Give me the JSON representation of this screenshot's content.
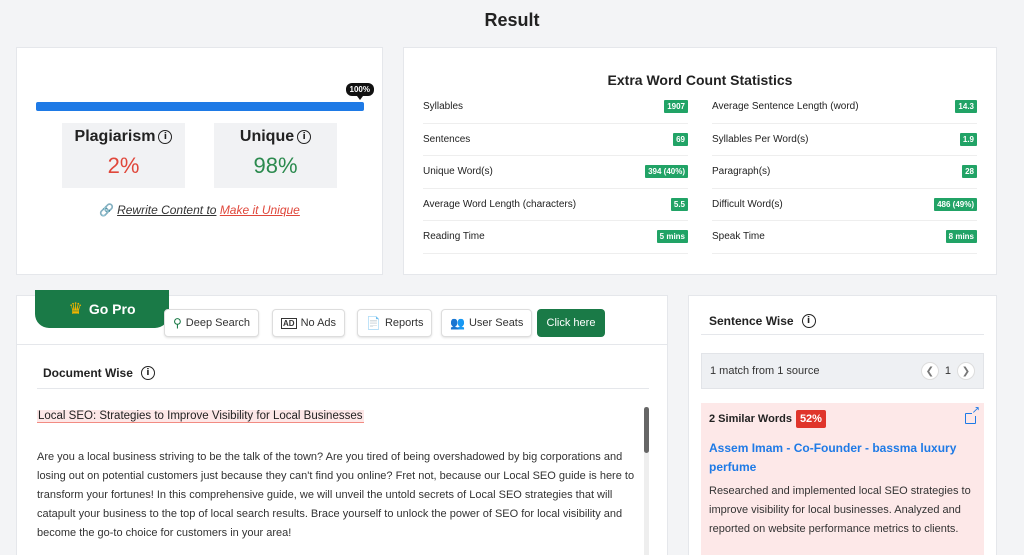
{
  "page_title": "Result",
  "score": {
    "progress_percent": 100,
    "progress_label": "100%",
    "plagiarism_label": "Plagiarism",
    "plagiarism_value": "2%",
    "unique_label": "Unique",
    "unique_value": "98%",
    "rewrite_text": "Rewrite Content to",
    "rewrite_link": "Make it Unique",
    "colors": {
      "plagiarism": "#e0473b",
      "unique": "#2b8a4e",
      "progress": "#1e7ae6"
    }
  },
  "stats": {
    "title": "Extra Word Count Statistics",
    "left": [
      {
        "label": "Syllables",
        "value": "1907"
      },
      {
        "label": "Sentences",
        "value": "69"
      },
      {
        "label": "Unique Word(s)",
        "value": "394 (40%)"
      },
      {
        "label": "Average Word Length (characters)",
        "value": "5.5"
      },
      {
        "label": "Reading Time",
        "value": "5 mins"
      }
    ],
    "right": [
      {
        "label": "Average Sentence Length (word)",
        "value": "14.3"
      },
      {
        "label": "Syllables Per Word(s)",
        "value": "1.9"
      },
      {
        "label": "Paragraph(s)",
        "value": "28"
      },
      {
        "label": "Difficult Word(s)",
        "value": "486 (49%)"
      },
      {
        "label": "Speak Time",
        "value": "8 mins"
      }
    ]
  },
  "pro": {
    "go_pro": "Go Pro",
    "features": [
      "Deep Search",
      "No Ads",
      "Reports",
      "User Seats"
    ],
    "cta": "Click here"
  },
  "document": {
    "title": "Document Wise",
    "heading": "Local SEO: Strategies to Improve Visibility for Local Businesses",
    "body": "Are you a local business striving to be the talk of the town? Are you tired of being overshadowed by big corporations and losing out on potential customers just because they can't find you online? Fret not, because our Local SEO guide is here to transform your fortunes! In this comprehensive guide, we will unveil the untold secrets of Local SEO strategies that will catapult your business to the top of local search results. Brace yourself to unlock the power of SEO for local visibility and become the go-to choice for customers in your area!"
  },
  "sentence": {
    "title": "Sentence Wise",
    "match_summary": "1 match from 1 source",
    "page": "1",
    "similar_words_label": "2 Similar Words",
    "similar_percent": "52%",
    "source_title": "Assem Imam - Co-Founder - bassma luxury perfume",
    "source_text": "Researched and implemented local SEO strategies to improve visibility for local businesses. Analyzed and reported on website performance metrics to clients."
  }
}
